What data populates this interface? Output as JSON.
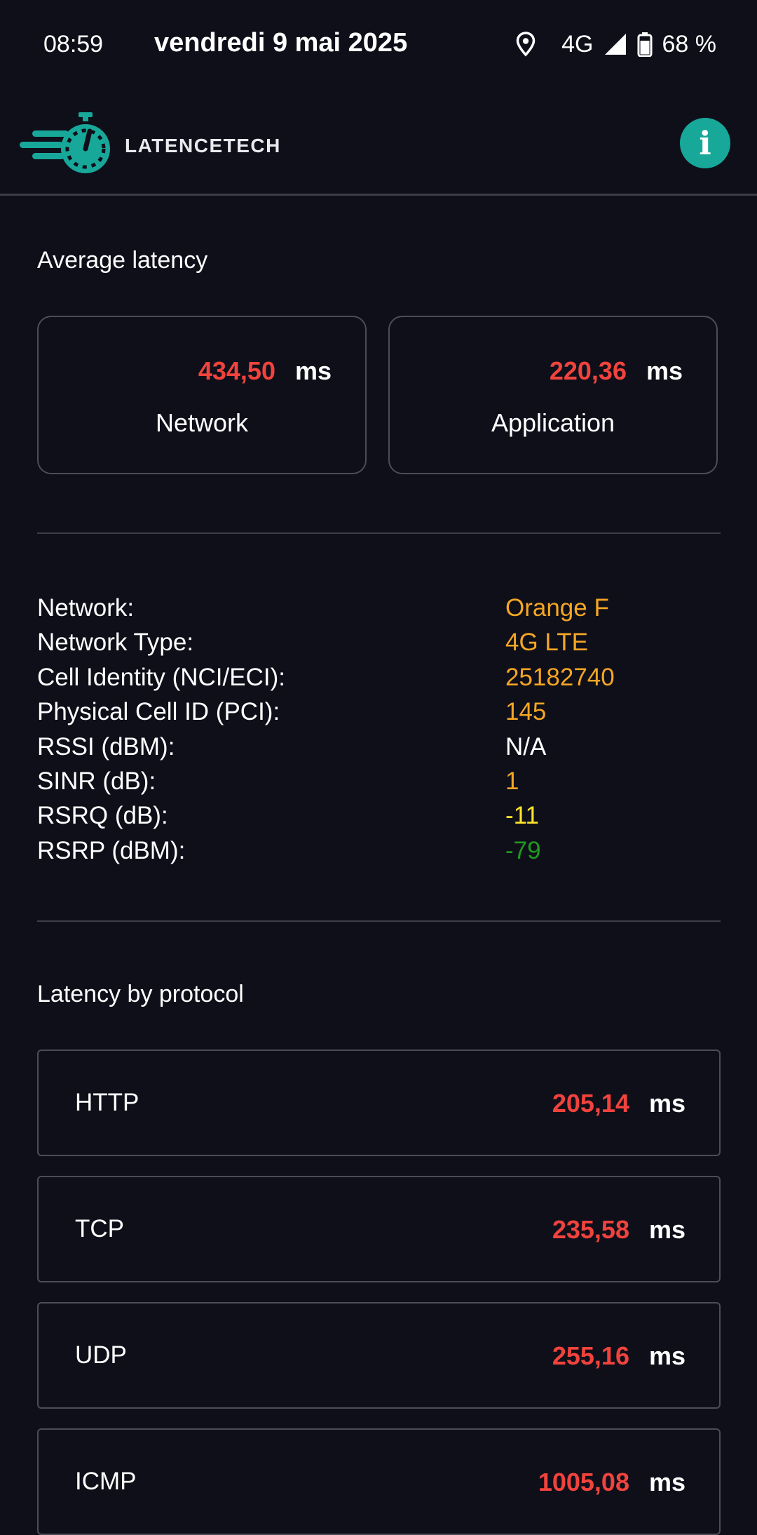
{
  "status_bar": {
    "time": "08:59",
    "date": "vendredi 9 mai 2025",
    "network": "4G",
    "battery": "68 %",
    "icons": [
      "location-icon",
      "signal-icon",
      "battery-icon"
    ]
  },
  "header": {
    "brand": "LATENCETECH",
    "info_label": "i",
    "accent_color": "#17a89a"
  },
  "average_latency": {
    "title": "Average latency",
    "cards": [
      {
        "value": "434,50",
        "unit": "ms",
        "label": "Network"
      },
      {
        "value": "220,36",
        "unit": "ms",
        "label": "Application"
      }
    ]
  },
  "network_info": [
    {
      "key": "Network:",
      "value": "Orange F",
      "color": "#f5a623"
    },
    {
      "key": "Network Type:",
      "value": "4G LTE",
      "color": "#f5a623"
    },
    {
      "key": "Cell Identity (NCI/ECI):",
      "value": "25182740",
      "color": "#f5a623"
    },
    {
      "key": "Physical Cell ID (PCI):",
      "value": "145",
      "color": "#f5a623"
    },
    {
      "key": "RSSI (dBM):",
      "value": "N/A",
      "color": "#ffffff"
    },
    {
      "key": "SINR (dB):",
      "value": "1",
      "color": "#f5a623"
    },
    {
      "key": "RSRQ (dB):",
      "value": "-11",
      "color": "#ffe52a"
    },
    {
      "key": "RSRP (dBM):",
      "value": "-79",
      "color": "#1f9a1c"
    }
  ],
  "protocols": {
    "title": "Latency by protocol",
    "items": [
      {
        "name": "HTTP",
        "value": "205,14",
        "unit": "ms"
      },
      {
        "name": "TCP",
        "value": "235,58",
        "unit": "ms"
      },
      {
        "name": "UDP",
        "value": "255,16",
        "unit": "ms"
      },
      {
        "name": "ICMP",
        "value": "1005,08",
        "unit": "ms"
      }
    ]
  },
  "colors": {
    "background": "#0f0f1a",
    "latency_value": "#f1433d"
  }
}
